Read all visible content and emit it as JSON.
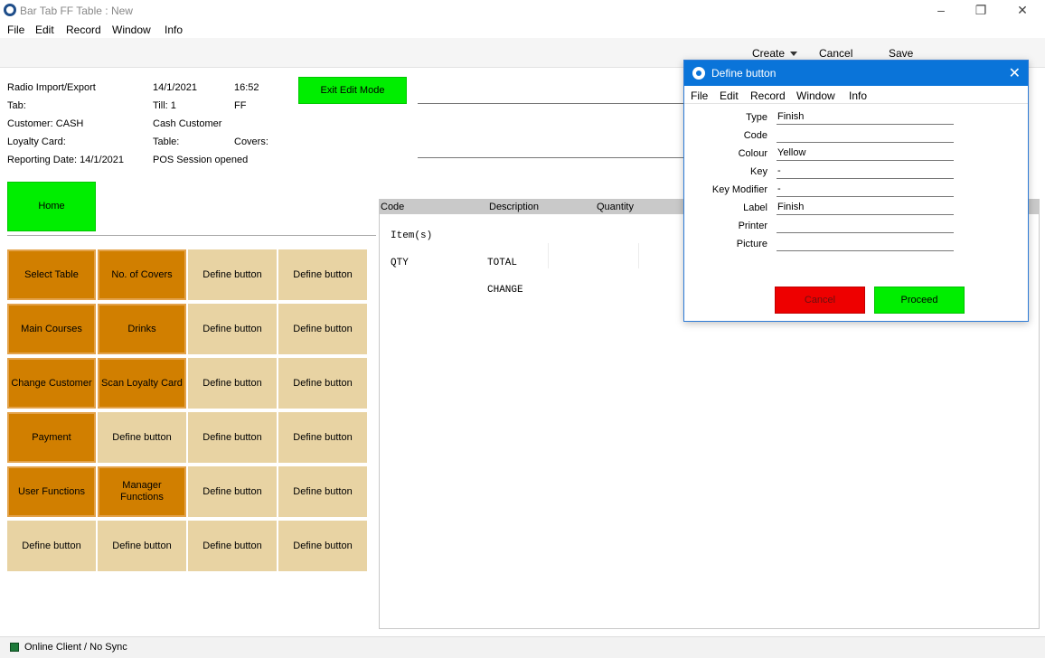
{
  "window": {
    "title": "Bar Tab FF Table : New"
  },
  "menu": [
    "File",
    "Edit",
    "Record",
    "Window",
    "Info"
  ],
  "toolbar": {
    "create": "Create",
    "cancel": "Cancel",
    "save": "Save"
  },
  "header": {
    "radio": "Radio Import/Export",
    "date": "14/1/2021",
    "time": "16:52",
    "tab": "Tab:",
    "till": "Till: 1",
    "till_code": "FF",
    "customer": "Customer: CASH",
    "customer_name": "Cash Customer",
    "loyalty": "Loyalty Card:",
    "table": "Table:",
    "covers": "Covers:",
    "reporting": "Reporting Date: 14/1/2021",
    "session": "POS Session opened",
    "exit_edit": "Exit Edit Mode",
    "home": "Home"
  },
  "grid": [
    [
      "Select Table",
      "No. of  Covers",
      "Define button",
      "Define button"
    ],
    [
      "Main Courses",
      "Drinks",
      "Define button",
      "Define button"
    ],
    [
      "Change Customer",
      "Scan Loyalty Card",
      "Define button",
      "Define button"
    ],
    [
      "Payment",
      "Define button",
      "Define button",
      "Define button"
    ],
    [
      "User Functions",
      "Manager Functions",
      "Define button",
      "Define button"
    ],
    [
      "Define button",
      "Define button",
      "Define button",
      "Define button"
    ]
  ],
  "grid_dark": [
    [
      true,
      true,
      false,
      false
    ],
    [
      true,
      true,
      false,
      false
    ],
    [
      true,
      true,
      false,
      false
    ],
    [
      true,
      false,
      false,
      false
    ],
    [
      true,
      true,
      false,
      false
    ],
    [
      false,
      false,
      false,
      false
    ]
  ],
  "items": {
    "col_code": "Code",
    "col_description": "Description",
    "col_quantity": "Quantity",
    "items_label": "Item(s)",
    "qty": "QTY",
    "total": "TOTAL",
    "change": "CHANGE"
  },
  "status": {
    "text": "Online Client / No Sync"
  },
  "dialog": {
    "title": "Define button",
    "menu": [
      "File",
      "Edit",
      "Record",
      "Window",
      "Info"
    ],
    "fields": [
      {
        "label": "Type",
        "value": "Finish"
      },
      {
        "label": "Code",
        "value": ""
      },
      {
        "label": "Colour",
        "value": "Yellow"
      },
      {
        "label": "Key",
        "value": "-"
      },
      {
        "label": "Key Modifier",
        "value": "-"
      },
      {
        "label": "Label",
        "value": "Finish"
      },
      {
        "label": "Printer",
        "value": ""
      },
      {
        "label": "Picture",
        "value": ""
      }
    ],
    "cancel": "Cancel",
    "proceed": "Proceed"
  }
}
